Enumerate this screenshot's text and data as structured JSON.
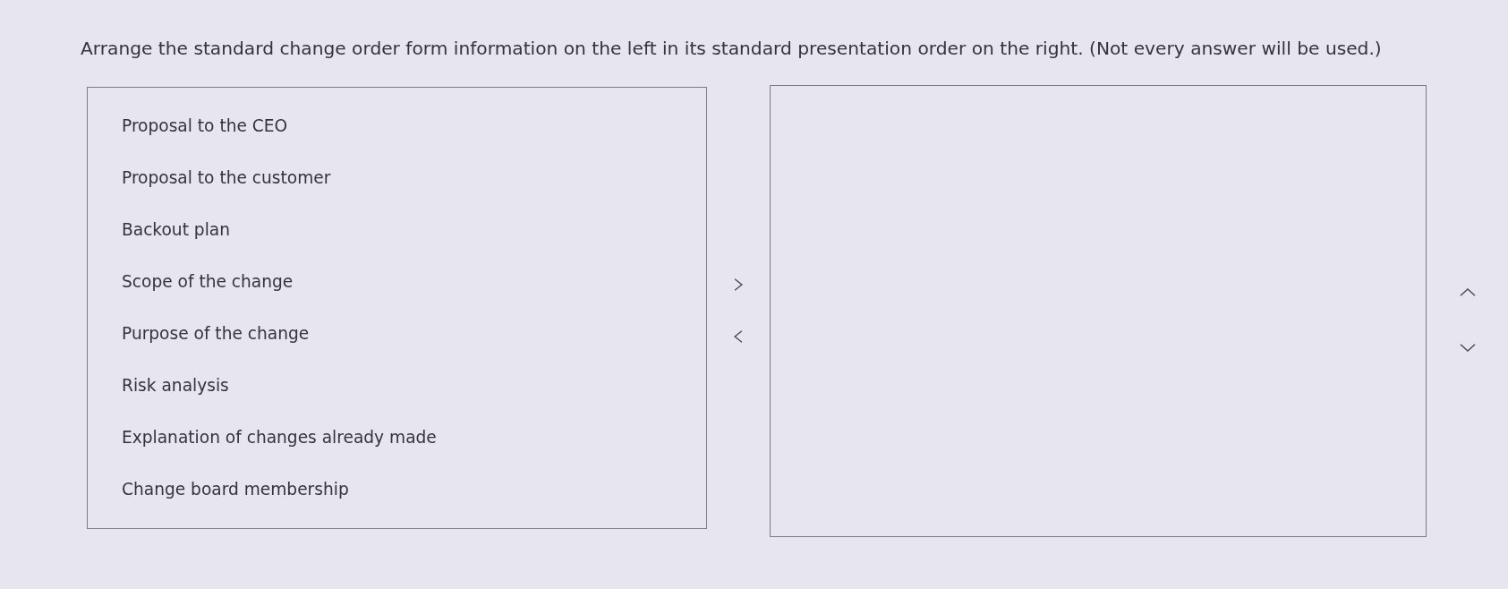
{
  "question": "Arrange the standard change order form information on the left in its standard presentation order on the right. (Not every answer will be used.)",
  "source_list": {
    "items": [
      {
        "label": "Proposal to the CEO"
      },
      {
        "label": "Proposal to the customer"
      },
      {
        "label": "Backout plan"
      },
      {
        "label": "Scope of the change"
      },
      {
        "label": "Purpose of the change"
      },
      {
        "label": "Risk analysis"
      },
      {
        "label": "Explanation of changes already made"
      },
      {
        "label": "Change board membership"
      }
    ]
  }
}
